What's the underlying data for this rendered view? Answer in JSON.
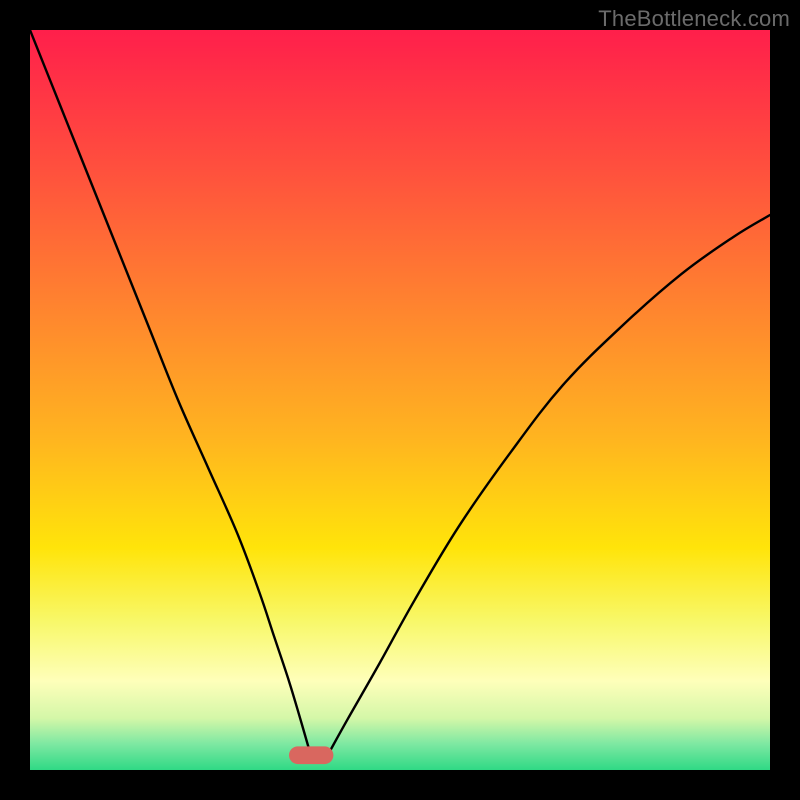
{
  "watermark": "TheBottleneck.com",
  "chart_data": {
    "type": "line",
    "title": "",
    "xlabel": "",
    "ylabel": "",
    "xlim": [
      0,
      100
    ],
    "ylim": [
      0,
      100
    ],
    "grid": false,
    "legend": false,
    "background": {
      "type": "vertical-gradient",
      "stops": [
        {
          "pos": 0.0,
          "color": "#ff1f4b"
        },
        {
          "pos": 0.18,
          "color": "#ff4e3e"
        },
        {
          "pos": 0.36,
          "color": "#ff8030"
        },
        {
          "pos": 0.55,
          "color": "#ffb420"
        },
        {
          "pos": 0.7,
          "color": "#ffe40a"
        },
        {
          "pos": 0.8,
          "color": "#f8f86a"
        },
        {
          "pos": 0.88,
          "color": "#feffba"
        },
        {
          "pos": 0.93,
          "color": "#d4f7a8"
        },
        {
          "pos": 0.965,
          "color": "#7de8a2"
        },
        {
          "pos": 1.0,
          "color": "#2fd985"
        }
      ]
    },
    "marker": {
      "x": 38,
      "y": 2,
      "width": 6,
      "height": 2.4,
      "color": "#d9675f",
      "shape": "rounded-rect"
    },
    "series": [
      {
        "name": "curve-left",
        "color": "#000000",
        "x": [
          0,
          4,
          8,
          12,
          16,
          20,
          24,
          28,
          31,
          33,
          35,
          36.5,
          37.8
        ],
        "y": [
          100,
          90,
          80,
          70,
          60,
          50,
          41,
          32,
          24,
          18,
          12,
          7,
          2.5
        ]
      },
      {
        "name": "curve-right",
        "color": "#000000",
        "x": [
          40.5,
          43,
          47,
          52,
          58,
          65,
          72,
          80,
          88,
          95,
          100
        ],
        "y": [
          2.5,
          7,
          14,
          23,
          33,
          43,
          52,
          60,
          67,
          72,
          75
        ]
      }
    ]
  }
}
